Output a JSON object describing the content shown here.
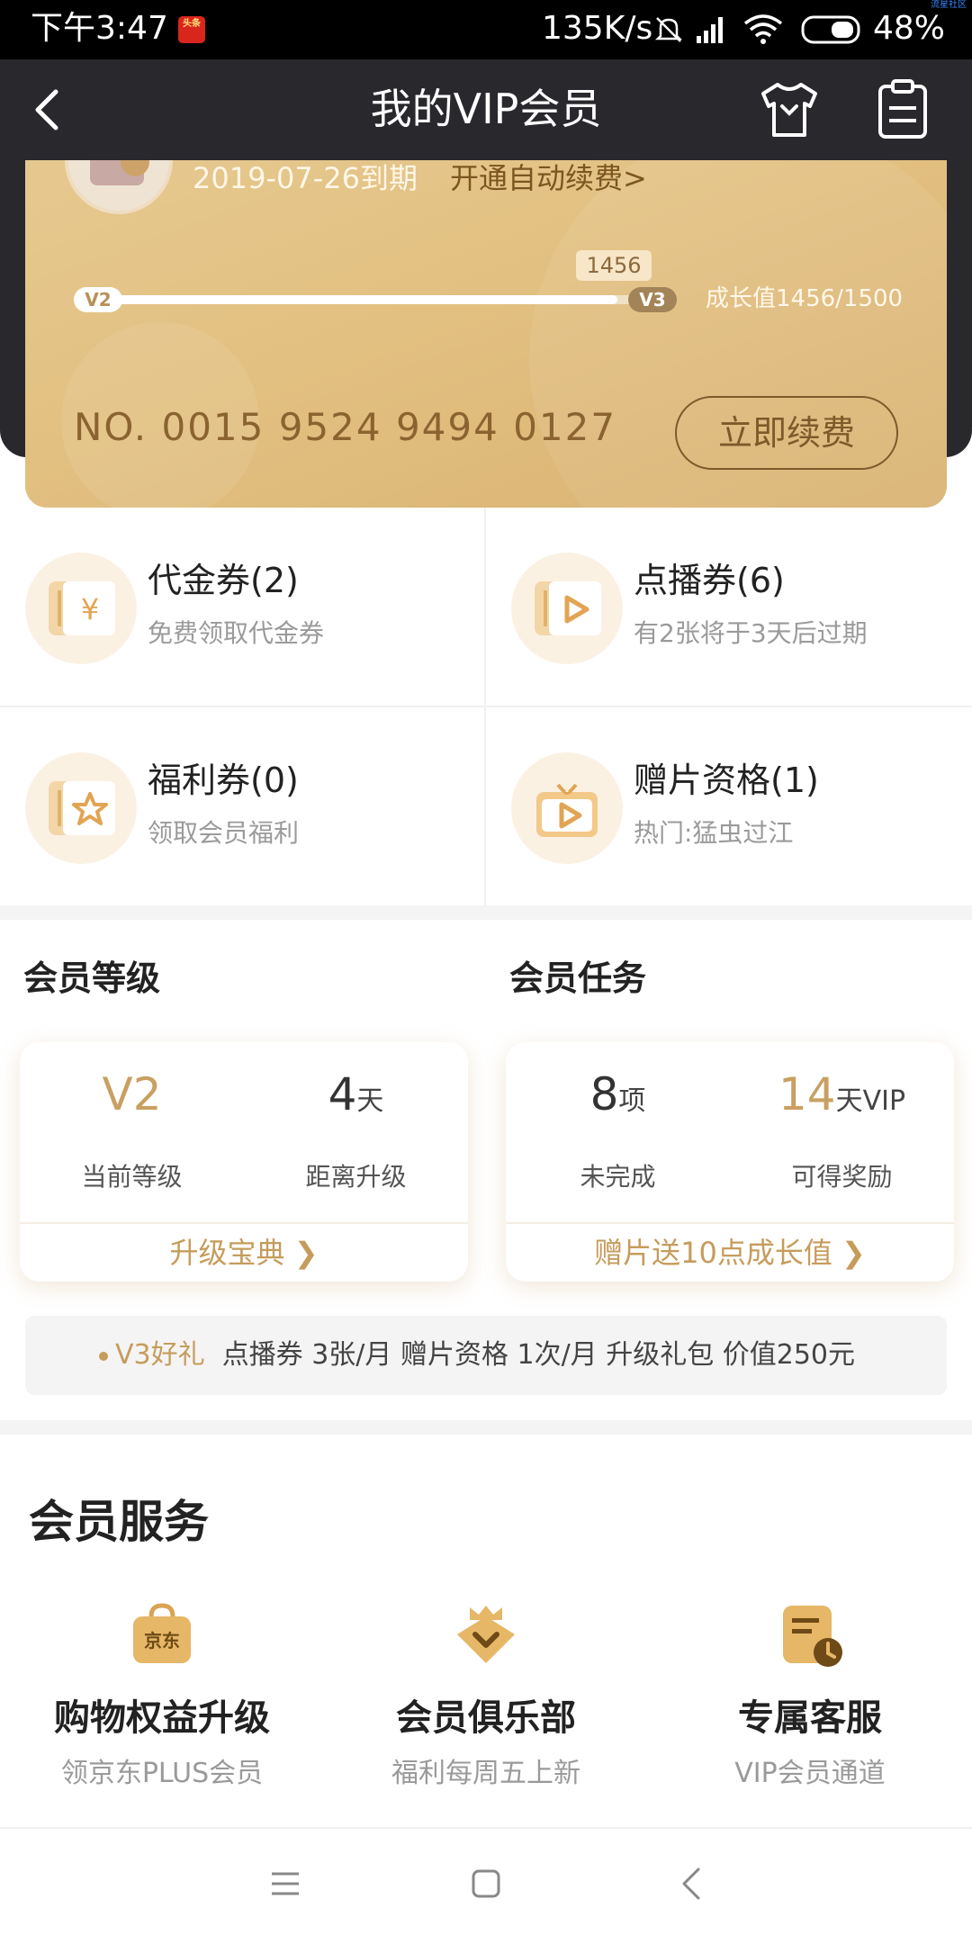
{
  "status_bar": {
    "time": "下午3:47",
    "app_badge": "头条",
    "net_speed": "135K/s",
    "battery": "48%",
    "watermark": "流星社区"
  },
  "header": {
    "title": "我的VIP会员",
    "back_icon": "chevron-left-icon",
    "shirt_icon": "tshirt-icon",
    "clipboard_icon": "clipboard-icon"
  },
  "card": {
    "expire_text": "2019-07-26到期",
    "auto_renew": "开通自动续费>",
    "level_from": "V2",
    "level_to": "V3",
    "growth_bubble": "1456",
    "growth_text": "成长值1456/1500",
    "growth_current": 1456,
    "growth_target": 1500,
    "card_no": "NO. 0015 9524 9494 0127",
    "renew_button": "立即续费",
    "accent_color": "#e2c081"
  },
  "coupons": [
    {
      "title": "代金券(2)",
      "sub": "免费领取代金券",
      "icon": "yen-ticket-icon"
    },
    {
      "title": "点播券(6)",
      "sub": "有2张将于3天后过期",
      "icon": "play-ticket-icon"
    },
    {
      "title": "福利券(0)",
      "sub": "领取会员福利",
      "icon": "star-ticket-icon"
    },
    {
      "title": "赠片资格(1)",
      "sub": "热门:猛虫过江",
      "icon": "gift-play-icon"
    }
  ],
  "level": {
    "section_title": "会员等级",
    "current_value": "V2",
    "current_label": "当前等级",
    "days_value": "4",
    "days_unit": "天",
    "days_label": "距离升级",
    "link": "升级宝典"
  },
  "tasks": {
    "section_title": "会员任务",
    "count_value": "8",
    "count_unit": "项",
    "count_label": "未完成",
    "reward_value": "14",
    "reward_unit": "天VIP",
    "reward_label": "可得奖励",
    "link": "赠片送10点成长值"
  },
  "v3_gift": {
    "label": "V3好礼",
    "text": "点播券  3张/月  赠片资格  1次/月  升级礼包  价值250元"
  },
  "services": {
    "title": "会员服务",
    "items": [
      {
        "title": "购物权益升级",
        "sub": "领京东PLUS会员",
        "icon": "shopping-bag-icon",
        "icon_text": "京东"
      },
      {
        "title": "会员俱乐部",
        "sub": "福利每周五上新",
        "icon": "crown-badge-icon"
      },
      {
        "title": "专属客服",
        "sub": "VIP会员通道",
        "icon": "service-clock-icon"
      }
    ]
  },
  "nav": {
    "menu_icon": "menu-icon",
    "home_icon": "home-square-icon",
    "back_icon": "nav-back-icon"
  }
}
